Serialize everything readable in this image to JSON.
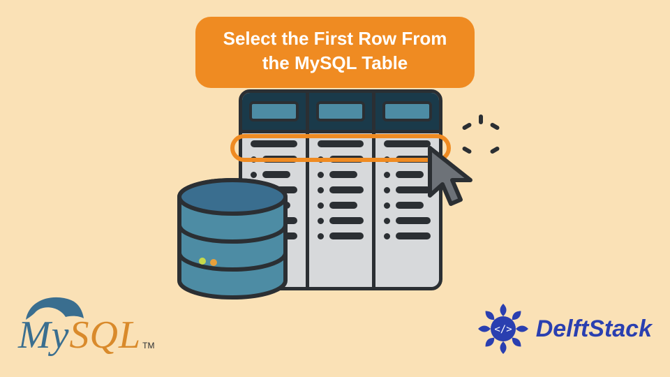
{
  "title": "Select the First Row From the MySQL Table",
  "logos": {
    "mysql_my": "My",
    "mysql_sql": "SQL",
    "mysql_tm": "TM",
    "delftstack": "DelftStack"
  },
  "colors": {
    "background": "#fae1b6",
    "accent_orange": "#ef8b22",
    "dark": "#2b2f33",
    "teal_dark": "#1a3a4a",
    "teal_mid": "#4d8ca4",
    "gray_panel": "#d7d9db",
    "delft_blue": "#2a3fb0",
    "mysql_blue": "#3a6e8f",
    "mysql_orange": "#d98a2b"
  },
  "illustration": {
    "table_columns": 3,
    "table_body_rows": 7,
    "highlighted_row_index": 0,
    "cursor_semantic": "mouse-pointer",
    "cylinder_semantic": "database"
  }
}
